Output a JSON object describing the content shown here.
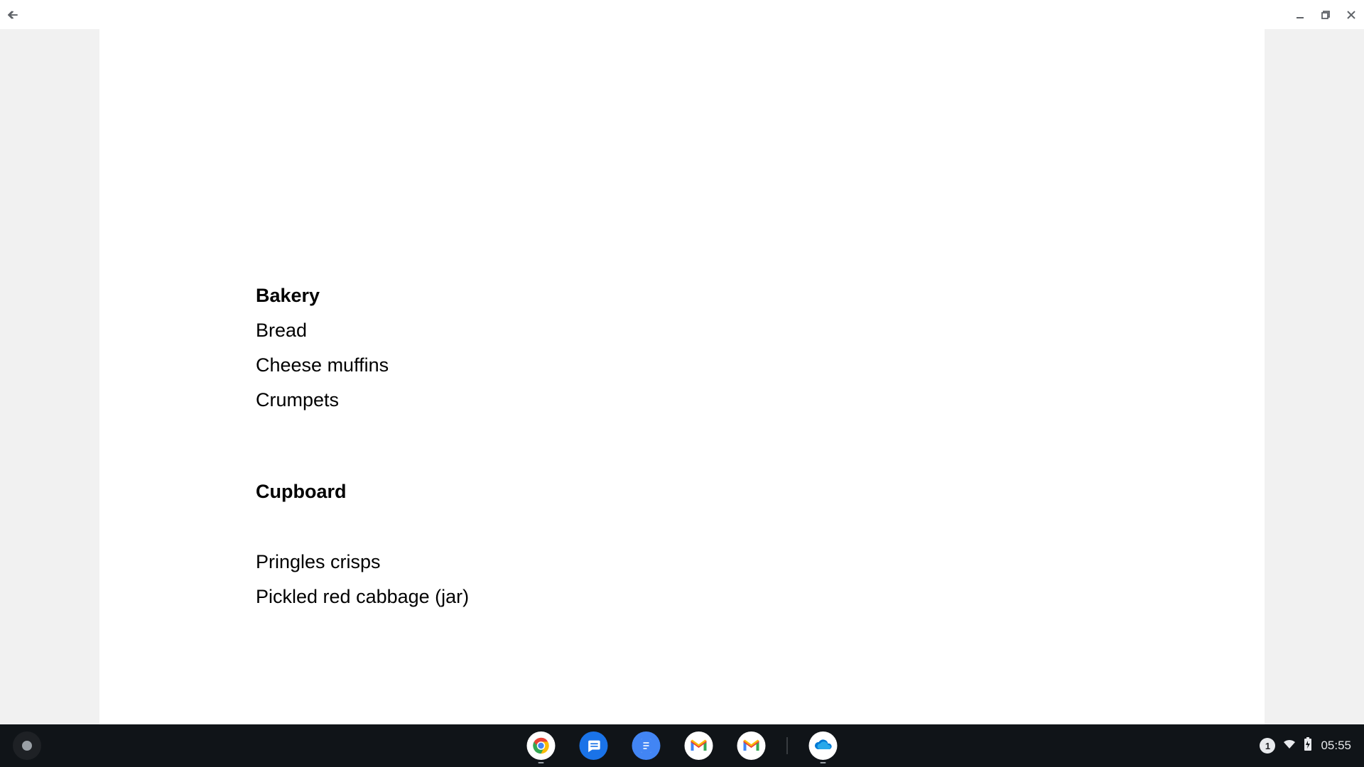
{
  "document": {
    "sections": [
      {
        "heading": "Bakery",
        "items": [
          "Bread",
          "Cheese muffins",
          "Crumpets"
        ]
      },
      {
        "heading": "Cupboard",
        "items": [
          "Pringles crisps",
          "Pickled red cabbage (jar)"
        ]
      }
    ]
  },
  "taskbar": {
    "notification_count": "1",
    "clock": "05:55"
  }
}
